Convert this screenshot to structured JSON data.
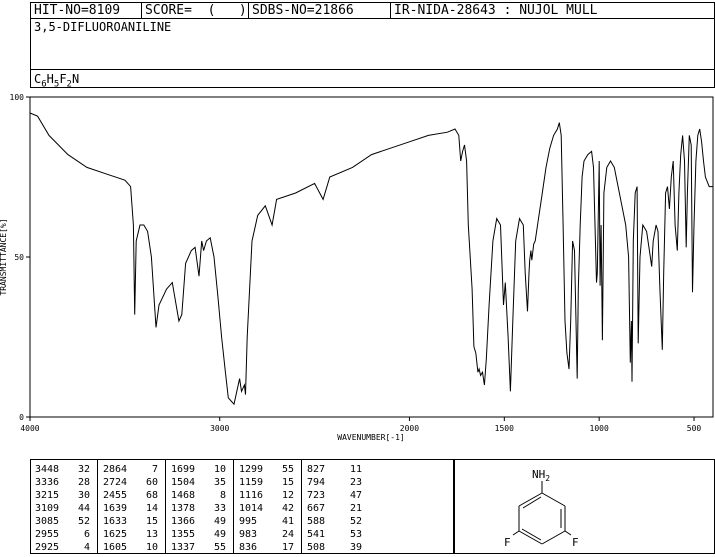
{
  "header": {
    "hit_no": "HIT-NO=8109",
    "score": "SCORE=  (   )",
    "sdbs_no": "SDBS-NO=21866",
    "ir_nida": "IR-NIDA-28643 : NUJOL MULL"
  },
  "compound_name": "3,5-DIFLUOROANILINE",
  "formula": {
    "c": "C",
    "c_n": "6",
    "h": "H",
    "h_n": "5",
    "f": "F",
    "f_n": "2",
    "n": "N"
  },
  "molecule": {
    "top_label": "NH",
    "top_sub": "2",
    "left_label": "F",
    "right_label": "F"
  },
  "chart_data": {
    "type": "line",
    "xlabel": "WAVENUMBER[-1]",
    "ylabel": "TRANSMITTANCE[%]",
    "xlim": [
      4000,
      400
    ],
    "ylim": [
      0,
      100
    ],
    "x_ticks": [
      4000,
      3000,
      2000,
      1500,
      1000,
      500
    ],
    "y_ticks": [
      0,
      50,
      100
    ],
    "series": [
      {
        "points": [
          [
            4000,
            95
          ],
          [
            3960,
            94
          ],
          [
            3900,
            88
          ],
          [
            3800,
            82
          ],
          [
            3700,
            78
          ],
          [
            3600,
            76
          ],
          [
            3500,
            74
          ],
          [
            3470,
            72
          ],
          [
            3455,
            60
          ],
          [
            3448,
            32
          ],
          [
            3440,
            55
          ],
          [
            3420,
            60
          ],
          [
            3400,
            60
          ],
          [
            3380,
            58
          ],
          [
            3360,
            50
          ],
          [
            3336,
            28
          ],
          [
            3320,
            35
          ],
          [
            3280,
            40
          ],
          [
            3250,
            42
          ],
          [
            3215,
            30
          ],
          [
            3200,
            32
          ],
          [
            3180,
            48
          ],
          [
            3150,
            52
          ],
          [
            3130,
            53
          ],
          [
            3109,
            44
          ],
          [
            3095,
            55
          ],
          [
            3085,
            52
          ],
          [
            3070,
            55
          ],
          [
            3050,
            56
          ],
          [
            3030,
            50
          ],
          [
            3010,
            38
          ],
          [
            2990,
            25
          ],
          [
            2970,
            14
          ],
          [
            2955,
            6
          ],
          [
            2940,
            5
          ],
          [
            2925,
            4
          ],
          [
            2910,
            8
          ],
          [
            2895,
            12
          ],
          [
            2885,
            8
          ],
          [
            2870,
            10
          ],
          [
            2864,
            7
          ],
          [
            2855,
            25
          ],
          [
            2830,
            55
          ],
          [
            2800,
            63
          ],
          [
            2760,
            66
          ],
          [
            2724,
            60
          ],
          [
            2700,
            68
          ],
          [
            2600,
            70
          ],
          [
            2500,
            73
          ],
          [
            2455,
            68
          ],
          [
            2420,
            75
          ],
          [
            2300,
            78
          ],
          [
            2200,
            82
          ],
          [
            2100,
            84
          ],
          [
            2000,
            86
          ],
          [
            1900,
            88
          ],
          [
            1800,
            89
          ],
          [
            1760,
            90
          ],
          [
            1740,
            88
          ],
          [
            1730,
            80
          ],
          [
            1720,
            83
          ],
          [
            1710,
            85
          ],
          [
            1699,
            80
          ],
          [
            1690,
            60
          ],
          [
            1670,
            40
          ],
          [
            1660,
            22
          ],
          [
            1650,
            20
          ],
          [
            1639,
            14
          ],
          [
            1633,
            15
          ],
          [
            1625,
            13
          ],
          [
            1615,
            14
          ],
          [
            1605,
            10
          ],
          [
            1595,
            18
          ],
          [
            1580,
            35
          ],
          [
            1560,
            55
          ],
          [
            1540,
            62
          ],
          [
            1520,
            60
          ],
          [
            1504,
            35
          ],
          [
            1495,
            42
          ],
          [
            1480,
            25
          ],
          [
            1468,
            8
          ],
          [
            1455,
            30
          ],
          [
            1440,
            55
          ],
          [
            1420,
            62
          ],
          [
            1400,
            60
          ],
          [
            1390,
            45
          ],
          [
            1378,
            33
          ],
          [
            1370,
            45
          ],
          [
            1366,
            49
          ],
          [
            1360,
            52
          ],
          [
            1355,
            49
          ],
          [
            1345,
            54
          ],
          [
            1337,
            55
          ],
          [
            1320,
            62
          ],
          [
            1300,
            70
          ],
          [
            1280,
            78
          ],
          [
            1260,
            84
          ],
          [
            1240,
            88
          ],
          [
            1220,
            90
          ],
          [
            1210,
            92
          ],
          [
            1200,
            88
          ],
          [
            1190,
            60
          ],
          [
            1180,
            30
          ],
          [
            1170,
            20
          ],
          [
            1159,
            15
          ],
          [
            1150,
            30
          ],
          [
            1140,
            55
          ],
          [
            1130,
            52
          ],
          [
            1116,
            12
          ],
          [
            1110,
            40
          ],
          [
            1100,
            60
          ],
          [
            1090,
            75
          ],
          [
            1080,
            80
          ],
          [
            1060,
            82
          ],
          [
            1040,
            83
          ],
          [
            1030,
            78
          ],
          [
            1014,
            42
          ],
          [
            1010,
            45
          ],
          [
            1000,
            80
          ],
          [
            995,
            41
          ],
          [
            990,
            60
          ],
          [
            983,
            24
          ],
          [
            975,
            70
          ],
          [
            960,
            78
          ],
          [
            940,
            80
          ],
          [
            920,
            78
          ],
          [
            900,
            72
          ],
          [
            880,
            66
          ],
          [
            860,
            60
          ],
          [
            845,
            50
          ],
          [
            836,
            17
          ],
          [
            830,
            30
          ],
          [
            827,
            11
          ],
          [
            820,
            55
          ],
          [
            810,
            70
          ],
          [
            800,
            72
          ],
          [
            794,
            23
          ],
          [
            785,
            50
          ],
          [
            770,
            60
          ],
          [
            750,
            58
          ],
          [
            735,
            52
          ],
          [
            723,
            47
          ],
          [
            715,
            55
          ],
          [
            700,
            60
          ],
          [
            690,
            58
          ],
          [
            680,
            40
          ],
          [
            667,
            21
          ],
          [
            660,
            45
          ],
          [
            650,
            70
          ],
          [
            640,
            72
          ],
          [
            630,
            65
          ],
          [
            620,
            75
          ],
          [
            610,
            80
          ],
          [
            600,
            60
          ],
          [
            588,
            52
          ],
          [
            580,
            70
          ],
          [
            570,
            82
          ],
          [
            560,
            88
          ],
          [
            550,
            80
          ],
          [
            541,
            53
          ],
          [
            535,
            70
          ],
          [
            525,
            88
          ],
          [
            515,
            85
          ],
          [
            508,
            39
          ],
          [
            500,
            60
          ],
          [
            490,
            80
          ],
          [
            480,
            88
          ],
          [
            470,
            90
          ],
          [
            460,
            86
          ],
          [
            450,
            80
          ],
          [
            440,
            75
          ],
          [
            420,
            72
          ],
          [
            400,
            72
          ]
        ]
      }
    ]
  },
  "peak_table": {
    "columns": [
      {
        "wn": [
          "3448",
          "3336",
          "3215",
          "3109",
          "3085",
          "2955",
          "2925"
        ],
        "t": [
          "32",
          "28",
          "30",
          "44",
          "52",
          "6",
          "4"
        ]
      },
      {
        "wn": [
          "2864",
          "2724",
          "2455",
          "1639",
          "1633",
          "1625",
          "1605"
        ],
        "t": [
          "7",
          "60",
          "68",
          "14",
          "15",
          "13",
          "10"
        ]
      },
      {
        "wn": [
          "1699",
          "1504",
          "1468",
          "1378",
          "1366",
          "1355",
          "1337"
        ],
        "t": [
          "10",
          "35",
          "8",
          "33",
          "49",
          "49",
          "55"
        ]
      },
      {
        "wn": [
          "1299",
          "1159",
          "1116",
          "1014",
          "995",
          "983",
          "836"
        ],
        "t": [
          "55",
          "15",
          "12",
          "42",
          "41",
          "24",
          "17"
        ]
      },
      {
        "wn": [
          "827",
          "794",
          "723",
          "667",
          "588",
          "541",
          "508"
        ],
        "t": [
          "11",
          "23",
          "47",
          "21",
          "52",
          "53",
          "39"
        ]
      }
    ]
  }
}
